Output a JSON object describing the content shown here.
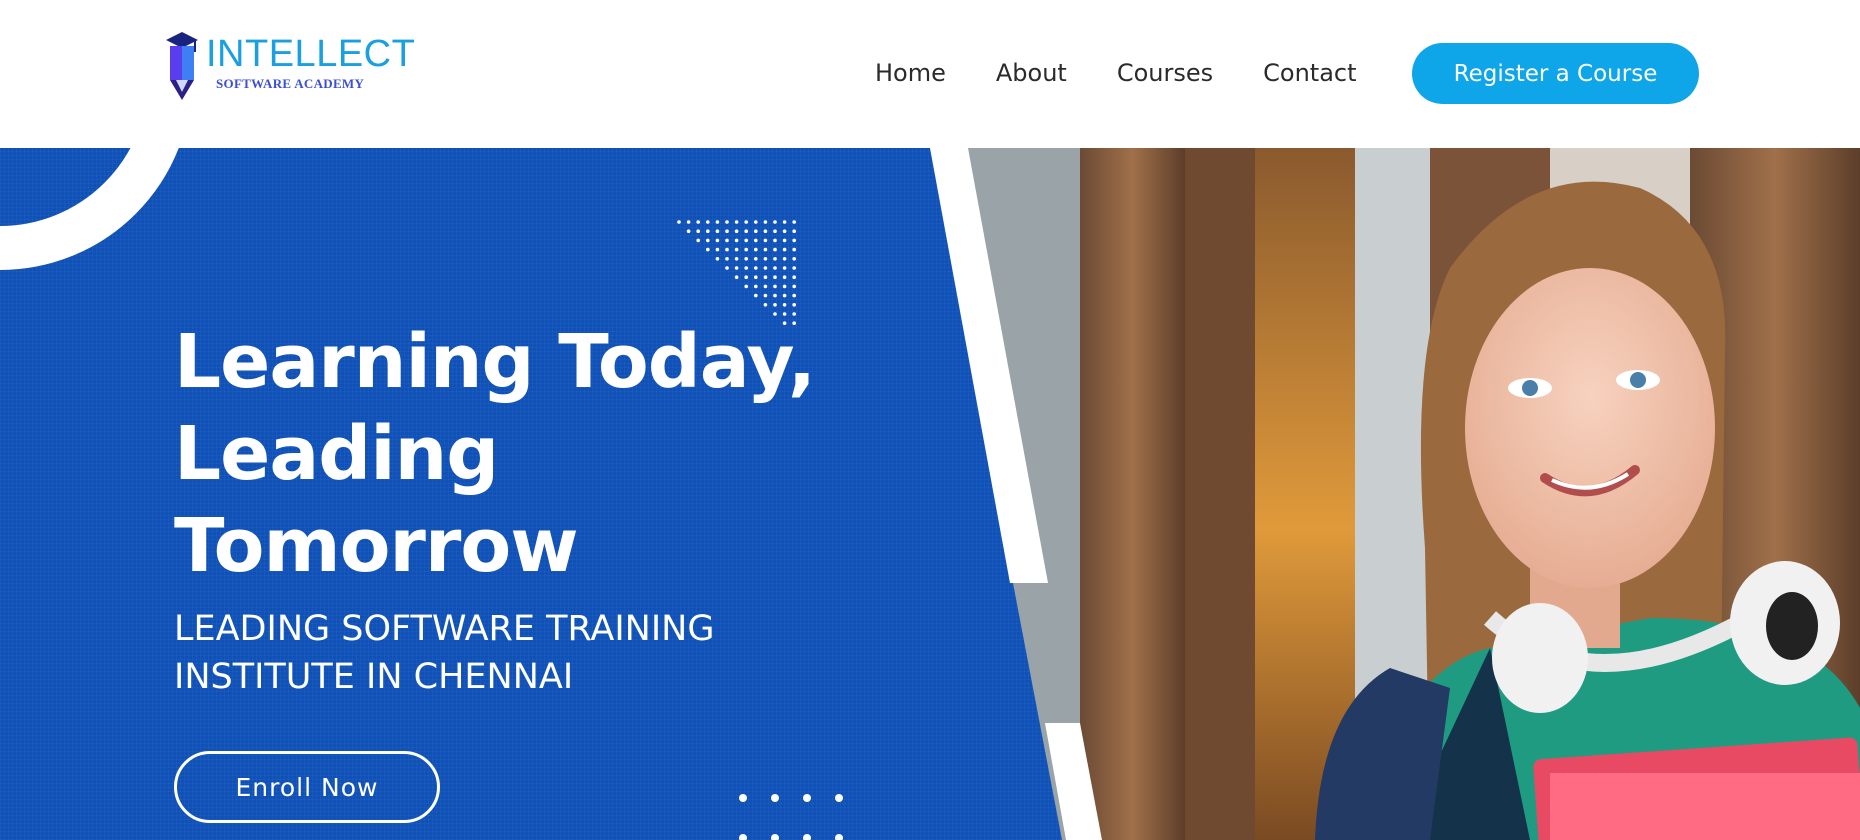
{
  "header": {
    "logo": {
      "name": "INTELLECT",
      "tagline": "SOFTWARE ACADEMY"
    },
    "nav": [
      {
        "label": "Home"
      },
      {
        "label": "About"
      },
      {
        "label": "Courses"
      },
      {
        "label": "Contact"
      }
    ],
    "cta_label": "Register a Course"
  },
  "hero": {
    "title": "Learning Today, Leading Tomorrow",
    "subtitle": "LEADING SOFTWARE TRAINING INSTITUTE IN CHENNAI",
    "button_label": "Enroll Now"
  },
  "colors": {
    "brand_blue": "#1051b8",
    "accent": "#0ea5e9",
    "logo_text": "#1aa0e0",
    "logo_icon": "#6a3de8"
  }
}
